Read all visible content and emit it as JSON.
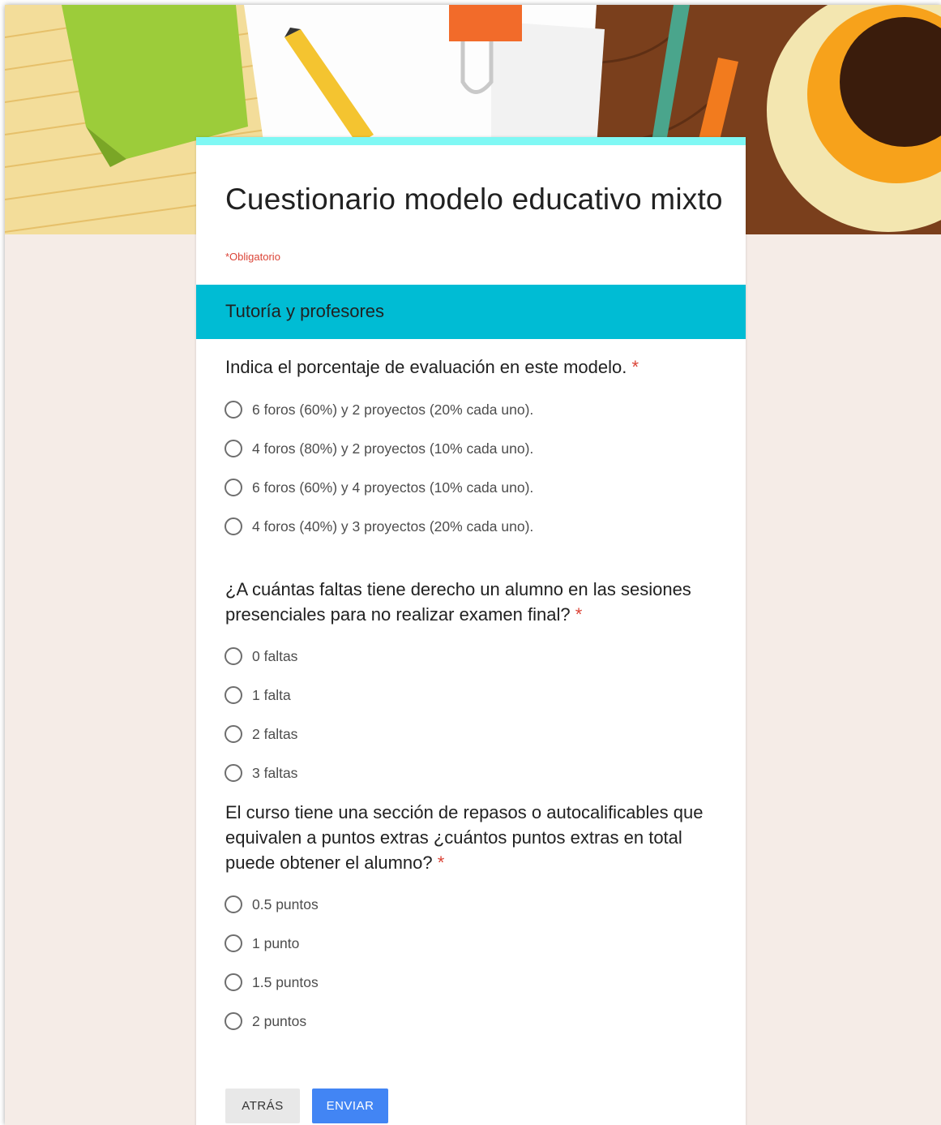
{
  "form": {
    "title": "Cuestionario modelo educativo mixto",
    "required_note": "*Obligatorio",
    "section_title": "Tutoría y profesores"
  },
  "questions": [
    {
      "text": "Indica el porcentaje de evaluación en este modelo.",
      "required_mark": "*",
      "options": [
        "6 foros (60%) y 2 proyectos (20% cada uno).",
        "4 foros (80%) y 2 proyectos (10% cada uno).",
        "6 foros (60%) y 4 proyectos (10% cada uno).",
        "4 foros (40%) y 3 proyectos (20% cada uno)."
      ]
    },
    {
      "text": "¿A cuántas faltas tiene derecho un alumno en las sesiones presenciales para no realizar examen final?",
      "required_mark": "*",
      "options": [
        "0 faltas",
        "1 falta",
        "2 faltas",
        "3 faltas"
      ]
    },
    {
      "text": "El curso tiene una sección de repasos o autocalificables que equivalen a puntos extras ¿cuántos puntos extras en total puede obtener el alumno?",
      "required_mark": "*",
      "options": [
        "0.5 puntos",
        "1 punto",
        "1.5 puntos",
        "2 puntos"
      ]
    }
  ],
  "buttons": {
    "back_label": "ATRÁS",
    "submit_label": "ENVIAR"
  },
  "colors": {
    "accent_bar": "#7ff8f4",
    "section_header": "#00bcd4",
    "submit_button": "#4285f4",
    "required": "#db4437",
    "page_background": "#f5ece7"
  }
}
